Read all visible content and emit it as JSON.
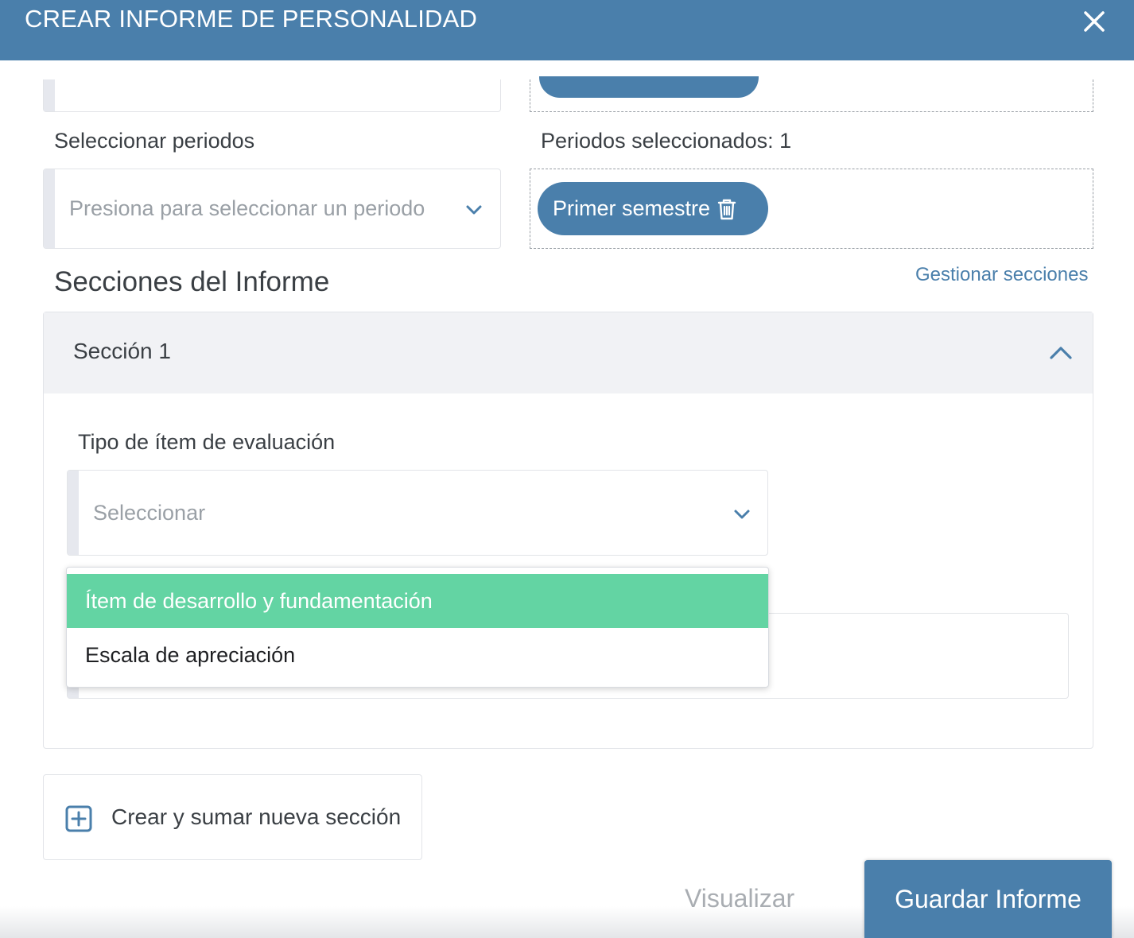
{
  "header": {
    "title": "CREAR INFORME DE PERSONALIDAD",
    "close_icon": "close-icon"
  },
  "periods": {
    "select_label": "Seleccionar periodos",
    "select_placeholder": "Presiona para seleccionar un periodo",
    "selected_label": "Periodos seleccionados: 1",
    "selected_chips": [
      {
        "label": "Primer semestre",
        "icon": "trash-icon"
      }
    ]
  },
  "sections": {
    "heading": "Secciones del Informe",
    "manage_link": "Gestionar secciones",
    "items": [
      {
        "title": "Sección 1",
        "expanded": true,
        "item_type_label": "Tipo de ítem de evaluación",
        "item_type_placeholder": "Seleccionar",
        "dropdown_options": [
          {
            "label": "Ítem de desarrollo y fundamentación",
            "highlighted": true
          },
          {
            "label": "Escala de apreciación",
            "highlighted": false
          }
        ]
      }
    ],
    "add_button": "Crear y sumar nueva sección"
  },
  "footer": {
    "preview_label": "Visualizar",
    "save_label": "Guardar Informe"
  },
  "colors": {
    "primary": "#4a7fab",
    "highlight": "#63d4a3",
    "text": "#3a3f44",
    "muted": "#9aa0a6"
  }
}
